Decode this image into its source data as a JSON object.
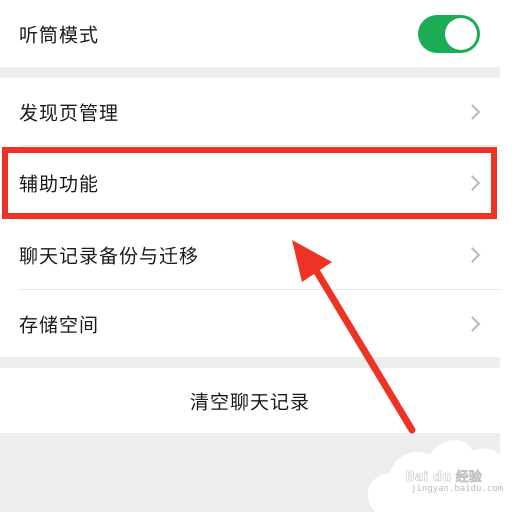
{
  "settings": {
    "receiver_mode": {
      "label": "听筒模式",
      "enabled": true
    },
    "items": [
      {
        "label": "发现页管理"
      },
      {
        "label": "辅助功能"
      },
      {
        "label": "聊天记录备份与迁移"
      },
      {
        "label": "存储空间"
      }
    ],
    "clear_chat_label": "清空聊天记录"
  },
  "annotation": {
    "highlight_color": "#ec3324",
    "highlighted_item": "辅助功能"
  },
  "watermark": {
    "brand": "Bai du 经验",
    "url": "jingyan.baidu.com"
  },
  "colors": {
    "toggle_on": "#1aad56",
    "background": "#ededed",
    "chevron": "#b8b8b8"
  }
}
